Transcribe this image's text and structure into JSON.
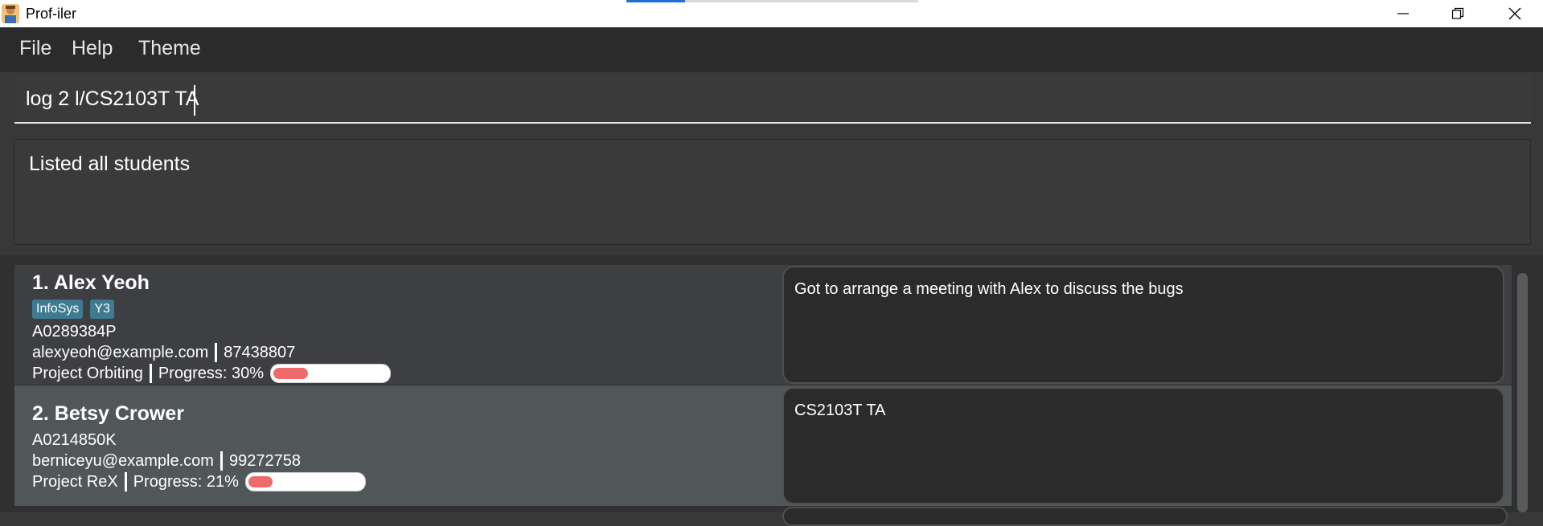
{
  "window": {
    "title": "Prof-iler"
  },
  "menu": {
    "items": [
      "File",
      "Help",
      "Theme"
    ]
  },
  "command": {
    "value": "log 2 l/CS2103T TA"
  },
  "result": {
    "message": "Listed all students"
  },
  "students": [
    {
      "name": "1. Alex Yeoh",
      "tags": [
        "InfoSys",
        "Y3"
      ],
      "student_id": "A0289384P",
      "email": "alexyeoh@example.com",
      "phone": "87438807",
      "project": "Project Orbiting",
      "progress_label": "Progress: 30%",
      "progress": 0.3,
      "note": "Got to arrange a meeting with Alex to discuss the bugs"
    },
    {
      "name": "2. Betsy Crower",
      "tags": [],
      "student_id": "A0214850K",
      "email": "berniceyu@example.com",
      "phone": "99272758",
      "project": "Project ReX",
      "progress_label": "Progress: 21%",
      "progress": 0.21,
      "note": "CS2103T TA"
    }
  ],
  "colors": {
    "background": "#383838",
    "menubar": "#2b2b2b",
    "card_odd": "#3e3f42",
    "card_even": "#515658",
    "tag": "#3e7b91",
    "progress_fill": "#ef6a6a",
    "title_accent": "#1f6fd6"
  },
  "icons": {
    "app": "profiler-avatar-icon",
    "minimize": "minimize-icon",
    "maximize": "restore-icon",
    "close": "close-icon"
  }
}
